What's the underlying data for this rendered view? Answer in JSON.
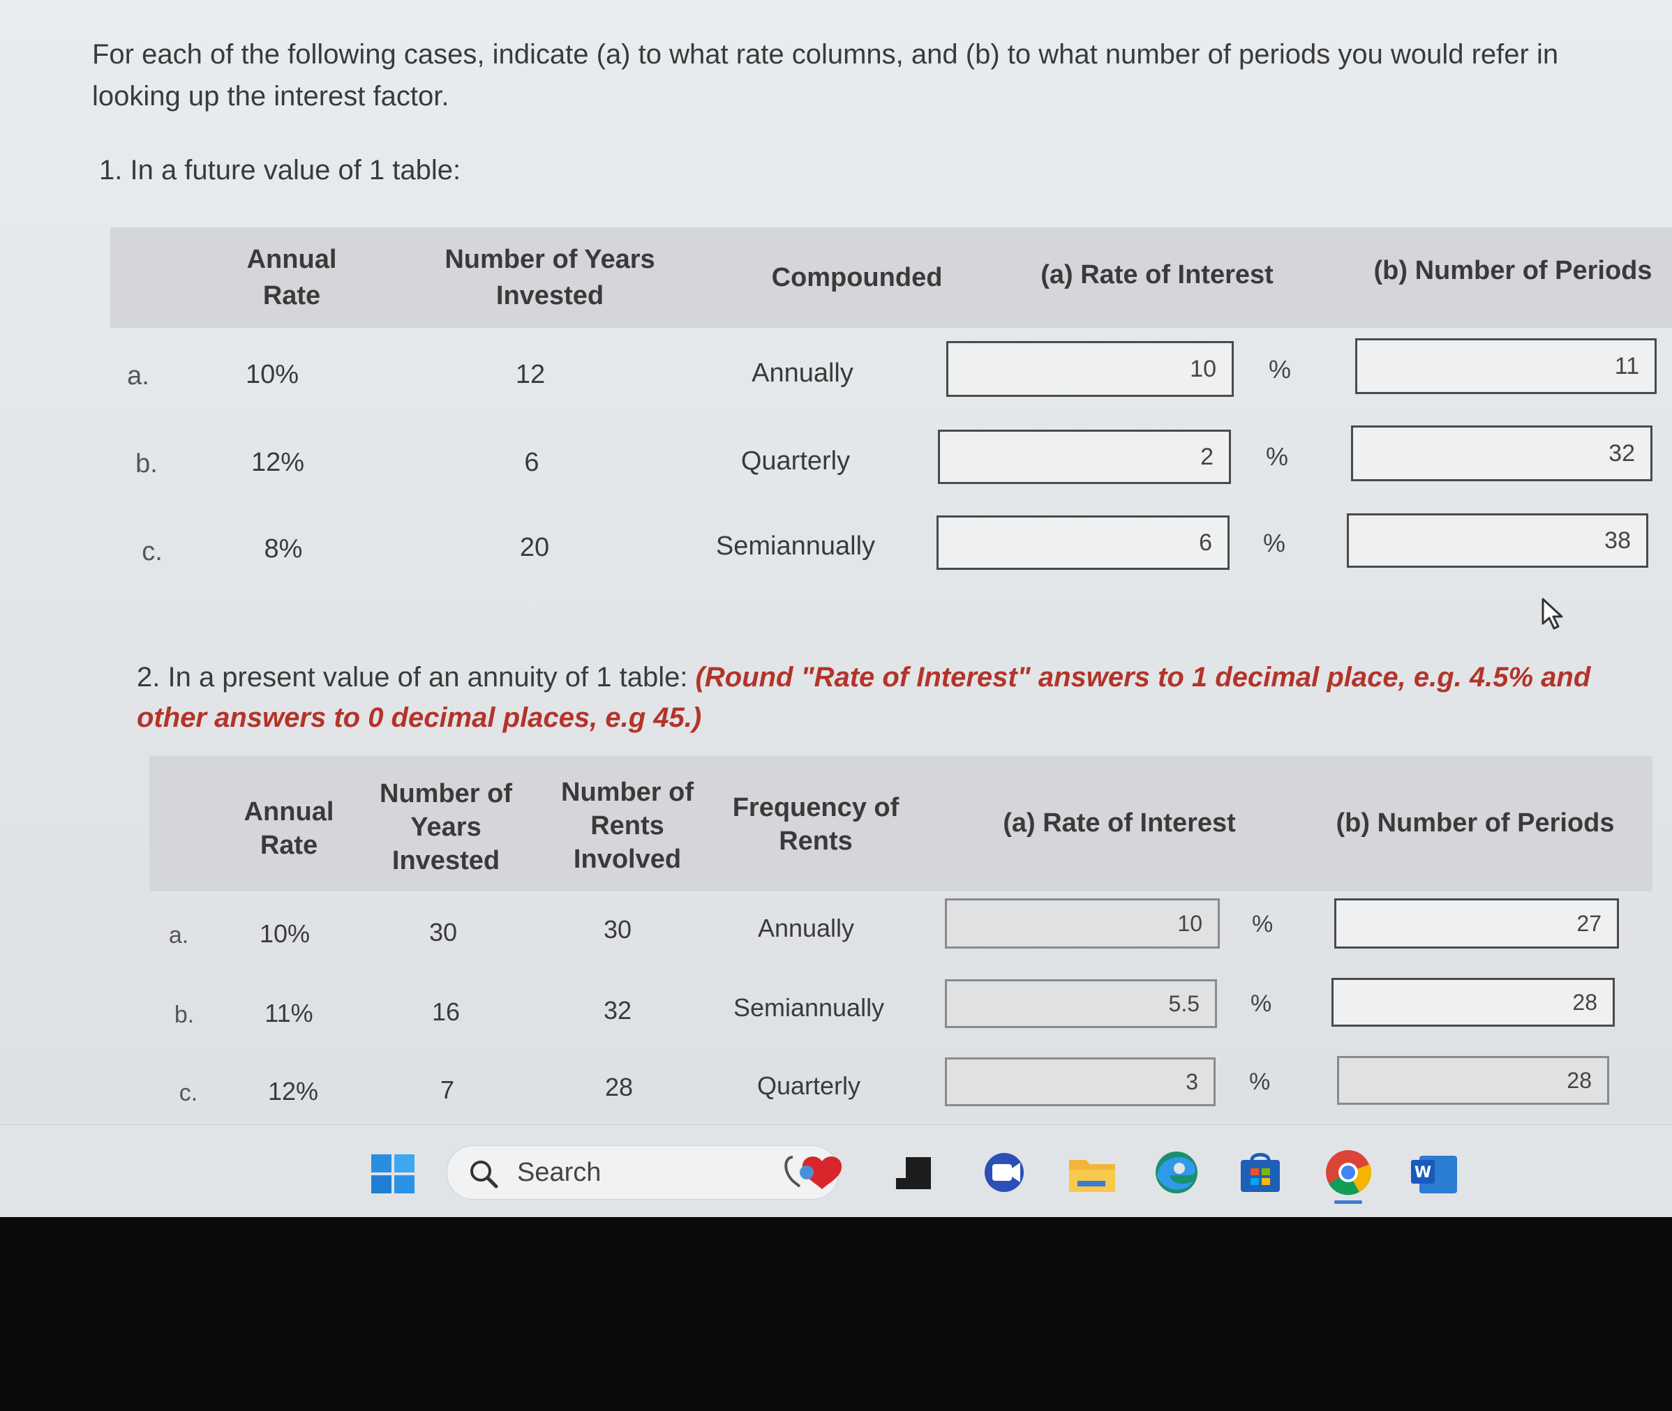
{
  "intro": "For each of the following cases, indicate (a) to what rate columns, and (b) to what number of periods you would refer in looking up the interest factor.",
  "part1": {
    "title": "1. In a future value of 1 table:",
    "headers": {
      "annual_rate": [
        "Annual",
        "Rate"
      ],
      "years": [
        "Number of Years",
        "Invested"
      ],
      "compounded": "Compounded",
      "rate_of_interest": "(a) Rate of Interest",
      "num_periods": "(b) Number of Periods"
    },
    "rows": [
      {
        "label": "a.",
        "rate": "10%",
        "years": "12",
        "compounded": "Annually",
        "a_value": "10",
        "b_value": "11"
      },
      {
        "label": "b.",
        "rate": "12%",
        "years": "6",
        "compounded": "Quarterly",
        "a_value": "2",
        "b_value": "32"
      },
      {
        "label": "c.",
        "rate": "8%",
        "years": "20",
        "compounded": "Semiannually",
        "a_value": "6",
        "b_value": "38"
      }
    ],
    "pct": "%"
  },
  "part2": {
    "title": "2. In a present value of an annuity of 1 table: ",
    "note": "(Round \"Rate of Interest\" answers to 1 decimal place, e.g. 4.5% and other answers to 0 decimal places, e.g 45.)",
    "headers": {
      "annual_rate": [
        "Annual",
        "Rate"
      ],
      "years": [
        "Number of",
        "Years",
        "Invested"
      ],
      "rents": [
        "Number of",
        "Rents",
        "Involved"
      ],
      "frequency": [
        "Frequency of",
        "Rents"
      ],
      "rate_of_interest": "(a) Rate of Interest",
      "num_periods": "(b) Number of Periods"
    },
    "rows": [
      {
        "label": "a.",
        "rate": "10%",
        "years": "30",
        "rents": "30",
        "frequency": "Annually",
        "a_value": "10",
        "b_value": "27"
      },
      {
        "label": "b.",
        "rate": "11%",
        "years": "16",
        "rents": "32",
        "frequency": "Semiannually",
        "a_value": "5.5",
        "b_value": "28"
      },
      {
        "label": "c.",
        "rate": "12%",
        "years": "7",
        "rents": "28",
        "frequency": "Quarterly",
        "a_value": "3",
        "b_value": "28"
      }
    ],
    "pct": "%"
  },
  "taskbar": {
    "search_label": "Search",
    "icons": [
      "windows-start-icon",
      "search-icon",
      "widgets-icon",
      "terminal-icon",
      "teams-icon",
      "file-explorer-icon",
      "edge-icon",
      "store-icon",
      "chrome-icon",
      "word-icon"
    ]
  }
}
